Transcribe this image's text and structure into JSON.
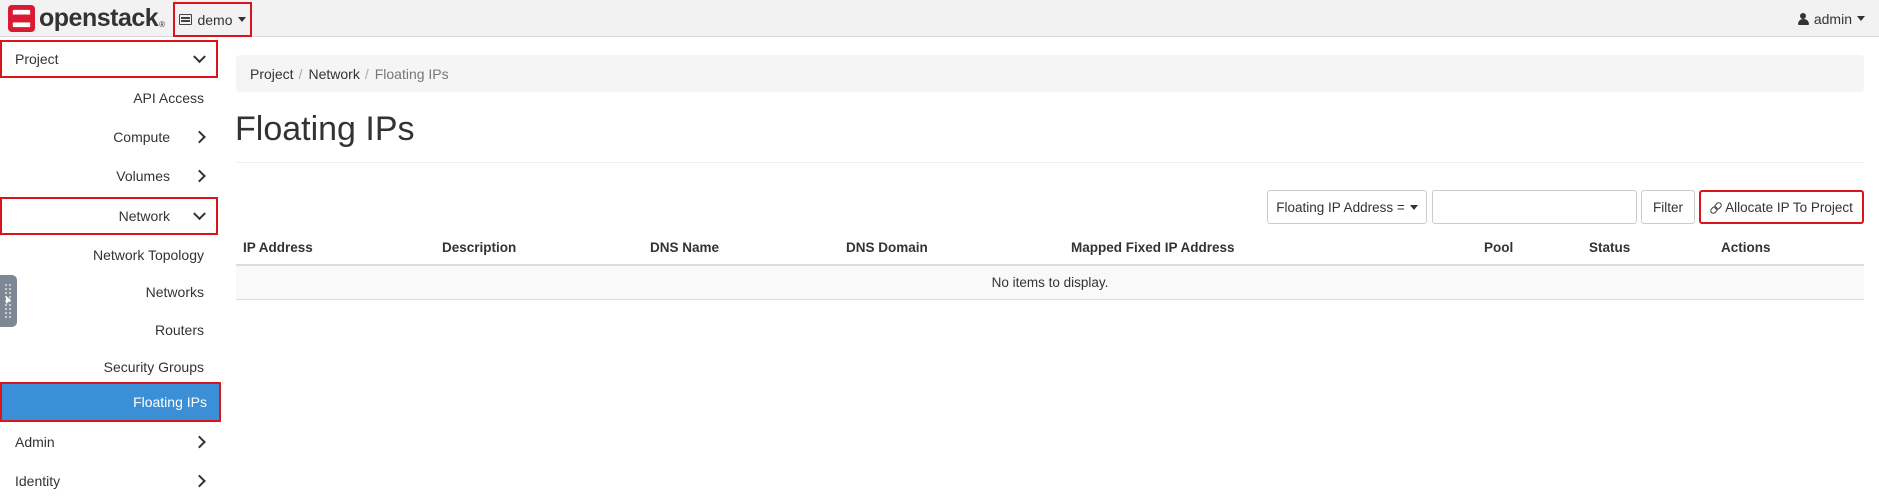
{
  "navbar": {
    "brand": "openstack",
    "brand_mark": "®",
    "project": "demo",
    "user": "admin"
  },
  "sidebar": {
    "project": "Project",
    "api_access": "API Access",
    "compute": "Compute",
    "volumes": "Volumes",
    "network": "Network",
    "network_topology": "Network Topology",
    "networks": "Networks",
    "routers": "Routers",
    "security_groups": "Security Groups",
    "floating_ips": "Floating IPs",
    "admin": "Admin",
    "identity": "Identity"
  },
  "breadcrumb": [
    "Project",
    "Network",
    "Floating IPs"
  ],
  "breadcrumb_sep": "/",
  "page_title": "Floating IPs",
  "toolbar": {
    "filter_field": "Floating IP Address =",
    "filter_value": "",
    "filter_button": "Filter",
    "allocate_button": "Allocate IP To Project"
  },
  "table": {
    "columns": [
      "IP Address",
      "Description",
      "DNS Name",
      "DNS Domain",
      "Mapped Fixed IP Address",
      "Pool",
      "Status",
      "Actions"
    ],
    "empty_message": "No items to display."
  },
  "colors": {
    "active_item": "#3b8fd6",
    "highlight_outline": "#d9141b",
    "brand_red": "#da1a32"
  }
}
